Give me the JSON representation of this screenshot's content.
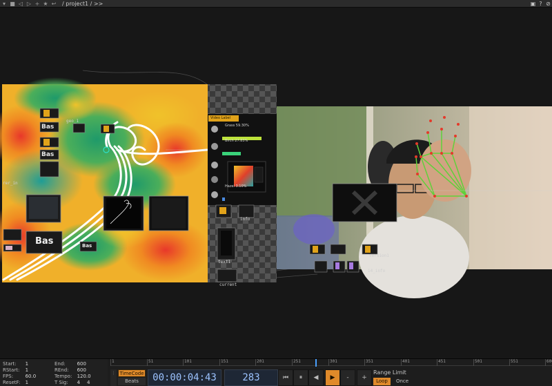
{
  "topbar": {
    "path": "/ project1 / >>",
    "icons": [
      "menu-arrow-icon",
      "stop-icon",
      "back-icon",
      "forward-icon",
      "add-icon",
      "star-icon",
      "return-icon"
    ],
    "right_icons": [
      "box-icon",
      "help-icon",
      "unlock-icon"
    ]
  },
  "network": {
    "label_bas_large": "Bas",
    "label_bas_1": "Bas",
    "label_bas_2": "Bas",
    "label_bas_3": "Bas",
    "label_rer": "rer_in",
    "label_geo": "geo_1",
    "label_text1": "text1",
    "label_info": "info",
    "label_current": "current",
    "label_info_right": "i4_info",
    "label_version": "version1"
  },
  "panel": {
    "title": "Video Label",
    "stats": [
      {
        "label": "Grass 59.30%",
        "fill": 0.95,
        "color": "#bde33a"
      },
      {
        "label": "Birch 27.83%",
        "fill": 0.45,
        "color": "#3ad37a"
      },
      {
        "label": "Hazel 3.10%",
        "fill": 0.06,
        "color": "#4a8ae0"
      }
    ]
  },
  "timeline": {
    "start_label": "Start:",
    "start_value": "1",
    "end_label": "End:",
    "end_value": "600",
    "rstart_label": "RStart:",
    "rstart_value": "1",
    "rend_label": "REnd:",
    "rend_value": "600",
    "fps_label": "FPS:",
    "fps_value": "60.0",
    "tempo_label": "Tempo:",
    "tempo_value": "120.0",
    "resetf_label": "ResetF:",
    "resetf_value": "1",
    "tsig_label": "T Sig:",
    "tsig_value_a": "4",
    "tsig_value_b": "4",
    "ruler_ticks": [
      "1",
      "51",
      "101",
      "151",
      "201",
      "251",
      "301",
      "351",
      "401",
      "451",
      "501",
      "551",
      "600"
    ],
    "playhead_frame": 283,
    "timecode_label": "TimeCode",
    "beats_label": "Beats",
    "timecode": "00:00:04:43",
    "frame": "283",
    "btn_rewind": "⏮",
    "btn_pause": "⏸",
    "btn_back": "◀",
    "btn_play": "▶",
    "btn_minus": "-",
    "btn_plus": "+",
    "range_limit": "Range Limit",
    "loop": "Loop",
    "once": "Once"
  }
}
